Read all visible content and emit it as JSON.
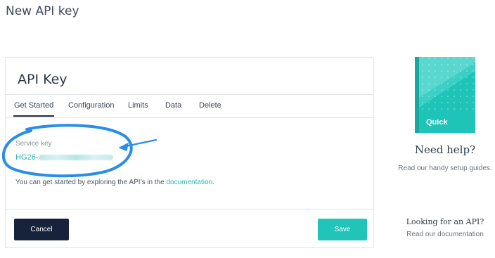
{
  "page": {
    "title": "New API key"
  },
  "card": {
    "title": "API Key",
    "tabs": [
      {
        "label": "Get Started",
        "active": true
      },
      {
        "label": "Configuration",
        "active": false
      },
      {
        "label": "Limits",
        "active": false
      },
      {
        "label": "Data",
        "active": false
      },
      {
        "label": "Delete",
        "active": false
      }
    ],
    "service_key_label": "Service key",
    "service_key_prefix": "HG26-",
    "help_text_prefix": "You can get started by exploring the API's in the ",
    "help_link": "documentation",
    "help_text_suffix": ".",
    "cancel_label": "Cancel",
    "save_label": "Save"
  },
  "sidebar": {
    "book_label": "Quick",
    "need_help_title": "Need help?",
    "need_help_text": "Read our handy setup guides.",
    "looking_title": "Looking for an API?",
    "looking_text": "Read our documentation"
  },
  "colors": {
    "accent": "#22c3b9",
    "link": "#1fb8b0",
    "dark_button": "#17223b",
    "annotation": "#2a8de6"
  }
}
